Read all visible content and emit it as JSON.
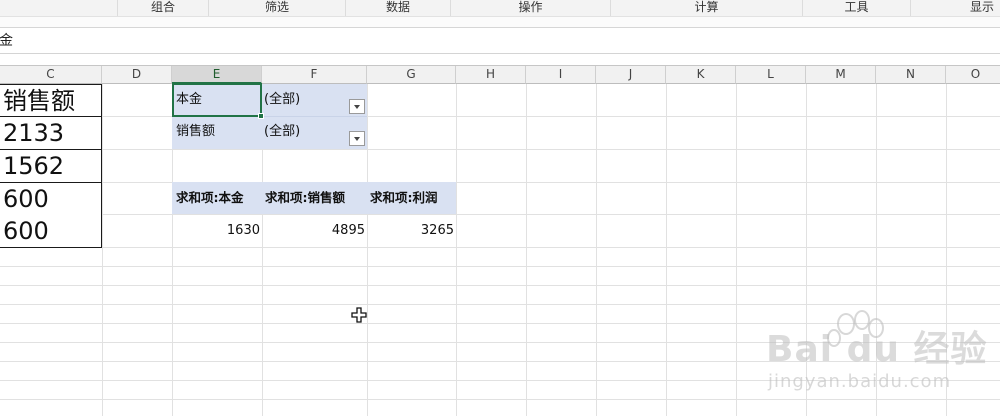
{
  "ribbon": {
    "groups": [
      "组合",
      "筛选",
      "数据",
      "操作",
      "计算",
      "工具",
      "显示"
    ]
  },
  "formula_bar": {
    "content": "金"
  },
  "columns": [
    "C",
    "D",
    "E",
    "F",
    "G",
    "H",
    "I",
    "J",
    "K",
    "L",
    "M",
    "N",
    "O"
  ],
  "selected_column": "E",
  "source_table": {
    "header": "销售额",
    "values": [
      "2133",
      "1562",
      "600",
      "600"
    ]
  },
  "pivot": {
    "filters": [
      {
        "field": "本金",
        "value": "(全部)"
      },
      {
        "field": "销售额",
        "value": "(全部)"
      }
    ],
    "value_headers": [
      "求和项:本金",
      "求和项:销售额",
      "求和项:利润"
    ],
    "totals": [
      "1630",
      "4895",
      "3265"
    ]
  },
  "watermark": {
    "brand": "Bai du 经验",
    "url": "jingyan.baidu.com"
  },
  "colors": {
    "accent": "#217346",
    "pivot_fill": "#d9e1f2"
  }
}
